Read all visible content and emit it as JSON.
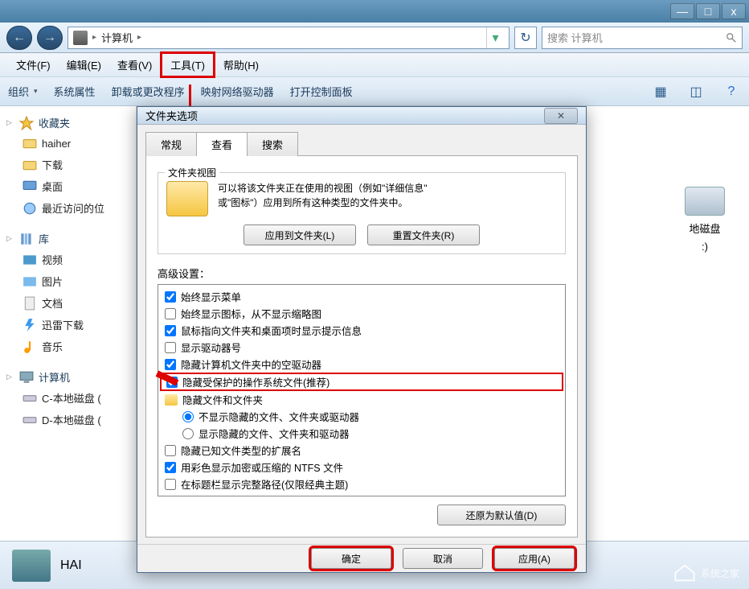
{
  "titlebar": {
    "min": "—",
    "max": "□",
    "close": "x"
  },
  "nav": {
    "back": "←",
    "fwd": "→",
    "location": "计算机",
    "sep": "▸",
    "refresh": "↻",
    "search_ph": "搜索 计算机"
  },
  "menubar": {
    "file": "文件(F)",
    "edit": "编辑(E)",
    "view": "查看(V)",
    "tools": "工具(T)",
    "help": "帮助(H)"
  },
  "toolbar": {
    "organize": "组织",
    "props": "系统属性",
    "uninstall": "卸载或更改程序",
    "mapdrive": "映射网络驱动器",
    "cpanel": "打开控制面板"
  },
  "sidebar": {
    "fav": {
      "head": "收藏夹",
      "items": [
        "haiher",
        "下载",
        "桌面",
        "最近访问的位"
      ]
    },
    "lib": {
      "head": "库",
      "items": [
        "视频",
        "图片",
        "文档",
        "迅雷下载",
        "音乐"
      ]
    },
    "pc": {
      "head": "计算机",
      "items": [
        "C-本地磁盘 (",
        "D-本地磁盘 ("
      ]
    }
  },
  "content": {
    "drive_label": "地磁盘",
    "drive_sub": ":)",
    "status": "HAI"
  },
  "dialog": {
    "title": "文件夹选项",
    "tabs": {
      "general": "常规",
      "view": "查看",
      "search": "搜索"
    },
    "view_legend": "文件夹视图",
    "view_desc1": "可以将该文件夹正在使用的视图（例如\"详细信息\"",
    "view_desc2": "或\"图标\"）应用到所有这种类型的文件夹中。",
    "apply_folders": "应用到文件夹(L)",
    "reset_folders": "重置文件夹(R)",
    "adv_label": "高级设置：",
    "adv": [
      {
        "type": "check",
        "checked": true,
        "label": "始终显示菜单"
      },
      {
        "type": "check",
        "checked": false,
        "label": "始终显示图标，从不显示缩略图"
      },
      {
        "type": "check",
        "checked": true,
        "label": "鼠标指向文件夹和桌面项时显示提示信息"
      },
      {
        "type": "check",
        "checked": false,
        "label": "显示驱动器号"
      },
      {
        "type": "check",
        "checked": true,
        "label": "隐藏计算机文件夹中的空驱动器"
      },
      {
        "type": "check",
        "checked": true,
        "label": "隐藏受保护的操作系统文件(推荐)",
        "hl": true
      },
      {
        "type": "folder",
        "label": "隐藏文件和文件夹"
      },
      {
        "type": "radio",
        "checked": true,
        "label": "不显示隐藏的文件、文件夹或驱动器",
        "indent": true
      },
      {
        "type": "radio",
        "checked": false,
        "label": "显示隐藏的文件、文件夹和驱动器",
        "indent": true
      },
      {
        "type": "check",
        "checked": false,
        "label": "隐藏已知文件类型的扩展名"
      },
      {
        "type": "check",
        "checked": true,
        "label": "用彩色显示加密或压缩的 NTFS 文件"
      },
      {
        "type": "check",
        "checked": false,
        "label": "在标题栏显示完整路径(仅限经典主题)"
      }
    ],
    "restore": "还原为默认值(D)",
    "ok": "确定",
    "cancel": "取消",
    "apply": "应用(A)"
  },
  "watermark": "系统之家"
}
